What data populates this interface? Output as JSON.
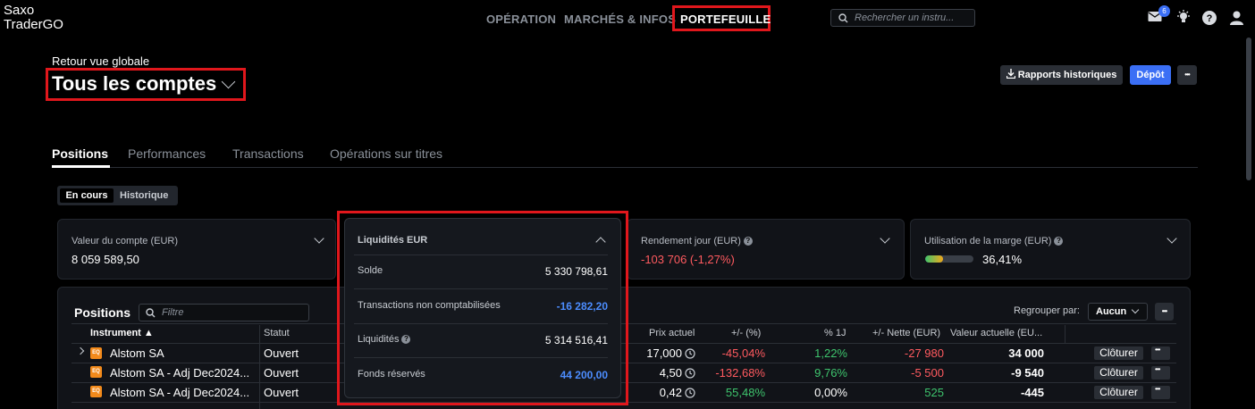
{
  "app": {
    "logo_line1": "Saxo",
    "logo_line2": "TraderGO"
  },
  "nav": {
    "operation": "OPÉRATION",
    "markets": "MARCHÉS & INFOS",
    "portfolio": "PORTEFEUILLE"
  },
  "search": {
    "placeholder": "Rechercher un instru..."
  },
  "header_icons": {
    "mail_badge": "6",
    "mail": "mail-icon",
    "bulb": "lightbulb-icon",
    "help": "help-icon",
    "user": "user-icon"
  },
  "account": {
    "back_link": "Retour vue globale",
    "title": "Tous les comptes"
  },
  "actions": {
    "reports": "Rapports historiques",
    "deposit": "Dépôt"
  },
  "tabs": [
    "Positions",
    "Performances",
    "Transactions",
    "Opérations sur titres"
  ],
  "toggle": {
    "current": "En cours",
    "history": "Historique"
  },
  "cards": {
    "account_value": {
      "label": "Valeur du compte (EUR)",
      "value": "8 059 589,50"
    },
    "liquidity": {
      "label": "Liquidités EUR",
      "rows": [
        {
          "label": "Solde",
          "value": "5 330 798,61"
        },
        {
          "label": "Transactions non comptabilisées",
          "value": "-16 282,20"
        },
        {
          "label": "Liquidités",
          "value": "5 314 516,41"
        },
        {
          "label": "Fonds réservés",
          "value": "44 200,00"
        }
      ]
    },
    "daily_return": {
      "label": "Rendement jour (EUR)",
      "value": "-103 706 (-1,27%)"
    },
    "margin": {
      "label": "Utilisation de la marge (EUR)",
      "value": "36,41%",
      "fill_fraction": 0.3641
    }
  },
  "positions": {
    "title": "Positions",
    "filter_placeholder": "Filtre",
    "group_label": "Regrouper par:",
    "group_value": "Aucun",
    "columns": {
      "instrument": "Instrument ▲",
      "status": "Statut",
      "price": "Prix actuel",
      "pct": "+/- (%)",
      "pct1j": "% 1J",
      "net": "+/- Nette (EUR)",
      "value": "Valeur actuelle (EU..."
    },
    "rows": [
      {
        "instrument": "Alstom SA",
        "status": "Ouvert",
        "price": "17,000",
        "pct": "-45,04%",
        "pct1j": "1,22%",
        "net": "-27 980",
        "value": "34 000",
        "close": "Clôturer"
      },
      {
        "instrument": "Alstom SA - Adj Dec2024...",
        "status": "Ouvert",
        "price": "4,50",
        "pct": "-132,68%",
        "pct1j": "9,76%",
        "net": "-5 500",
        "value": "-9 540",
        "close": "Clôturer"
      },
      {
        "instrument": "Alstom SA - Adj Dec2024...",
        "status": "Ouvert",
        "price": "0,42",
        "pct": "55,48%",
        "pct1j": "0,00%",
        "net": "525",
        "value": "-445",
        "close": "Clôturer"
      }
    ]
  },
  "colors": {
    "accent": "#3b6ff5",
    "negative": "#ff5a5f",
    "positive": "#3ec46d",
    "highlight": "#e0171c"
  }
}
